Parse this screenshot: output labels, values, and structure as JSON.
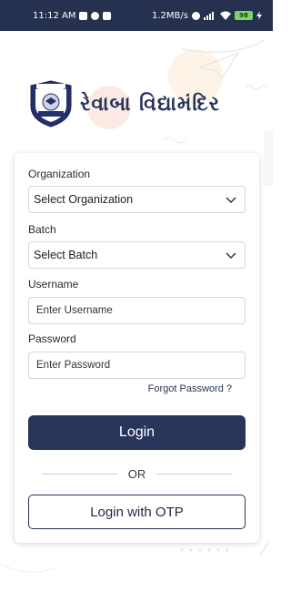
{
  "status_bar": {
    "time": "11:12 AM",
    "speed": "1.2MB/s",
    "battery": "98"
  },
  "brand": {
    "name": "રેવાબા વિદ્યામંદિર"
  },
  "form": {
    "organization_label": "Organization",
    "organization_value": "Select Organization",
    "batch_label": "Batch",
    "batch_value": "Select Batch",
    "username_label": "Username",
    "username_placeholder": "Enter Username",
    "password_label": "Password",
    "password_placeholder": "Enter Password",
    "forgot_password": "Forgot Password ?",
    "login_button": "Login",
    "or_text": "OR",
    "otp_button": "Login with OTP"
  },
  "colors": {
    "primary": "#28345a",
    "status_bar": "#25314f",
    "battery": "#7cd46a"
  }
}
